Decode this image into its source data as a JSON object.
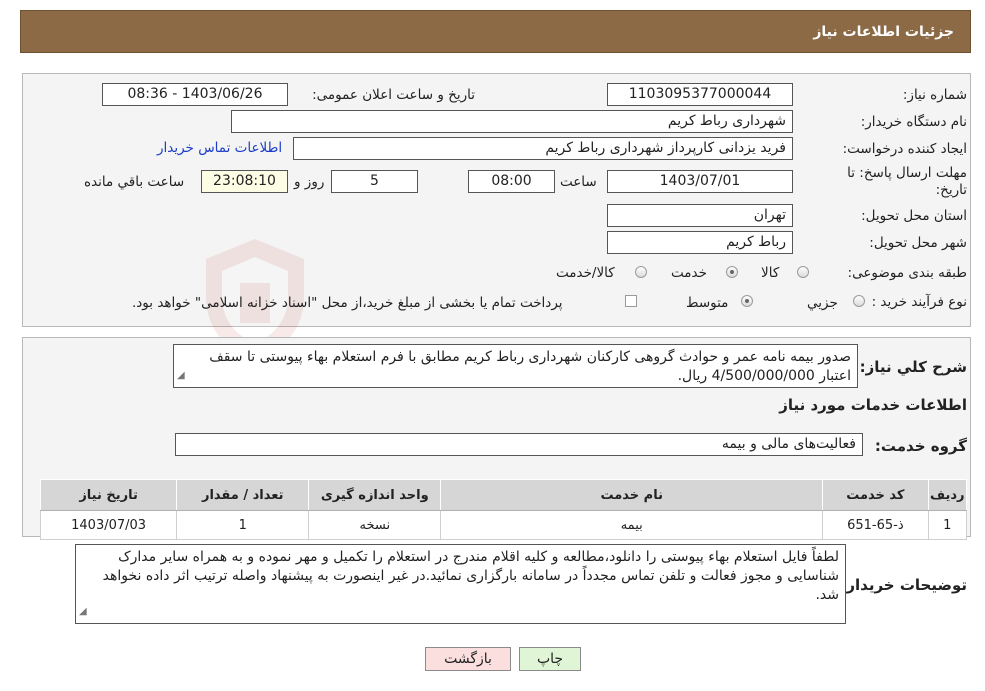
{
  "header": {
    "title": "جزئیات اطلاعات نیاز"
  },
  "form": {
    "need_number_label": "شماره نیاز:",
    "need_number": "1103095377000044",
    "announce_label": "تاریخ و ساعت اعلان عمومی:",
    "announce_value": "1403/06/26 - 08:36",
    "buyer_org_label": "نام دستگاه خریدار:",
    "buyer_org": "شهرداری رباط کریم",
    "creator_label": "ایجاد کننده درخواست:",
    "creator": "فرید یزدانی کارپرداز شهرداری رباط کریم",
    "contact_link": "اطلاعات تماس خریدار",
    "deadline_label_1": "مهلت ارسال پاسخ: تا",
    "deadline_label_2": "تاریخ:",
    "deadline_date": "1403/07/01",
    "time_label": "ساعت",
    "deadline_time": "08:00",
    "days_value": "5",
    "days_label": "روز و",
    "remaining_time": "23:08:10",
    "remaining_label": "ساعت باقي مانده",
    "province_label": "استان محل تحویل:",
    "province": "تهران",
    "city_label": "شهر محل تحویل:",
    "city": "رباط کریم",
    "category_label": "طبقه بندی موضوعی:",
    "category_options": [
      "کالا",
      "خدمت",
      "کالا/خدمت"
    ],
    "category_selected": "خدمت",
    "process_label": "نوع فرآیند خرید :",
    "process_options": [
      "جزیي",
      "متوسط"
    ],
    "process_selected": "متوسط",
    "treasury_note": "پرداخت تمام یا بخشی از مبلغ خرید،از محل \"اسناد خزانه اسلامی\" خواهد بود."
  },
  "description": {
    "label": "شرح کلي نیاز:",
    "text": "صدور بیمه نامه عمر و حوادث گروهی کارکنان شهرداری رباط کریم مطابق با فرم استعلام بهاء پیوستی تا سقف اعتبار 4/500/000/000 ریال."
  },
  "services": {
    "section_title": "اطلاعات خدمات مورد نیاز",
    "group_label": "گروه خدمت:",
    "group_value": "فعالیت‌های مالی و بیمه",
    "columns": [
      "ردیف",
      "کد خدمت",
      "نام خدمت",
      "واحد اندازه گیری",
      "تعداد / مقدار",
      "تاریخ نیاز"
    ],
    "rows": [
      [
        "1",
        "ذ-65-651",
        "بیمه",
        "نسخه",
        "1",
        "1403/07/03"
      ]
    ]
  },
  "buyer_notes": {
    "label": "توضیحات خریدار:",
    "text": "لطفاً فایل استعلام بهاء پیوستی را دانلود،مطالعه و کلیه اقلام مندرج در استعلام را تکمیل و مهر نموده و به همراه سایر مدارک شناسایی و مجوز فعالت و تلفن تماس مجدداً در سامانه بارگزاری نمائید.در غیر اینصورت به پیشنهاد واصله ترتیب اثر داده نخواهد شد."
  },
  "buttons": {
    "print": "چاپ",
    "back": "بازگشت"
  },
  "colors": {
    "header_bg": "#8b6a45",
    "link": "#1a3cc8",
    "print_btn": "#dff5d6",
    "back_btn": "#fbdede"
  },
  "icons": {
    "watermark": "shield-logo-icon",
    "resize": "resize-grip-icon"
  }
}
